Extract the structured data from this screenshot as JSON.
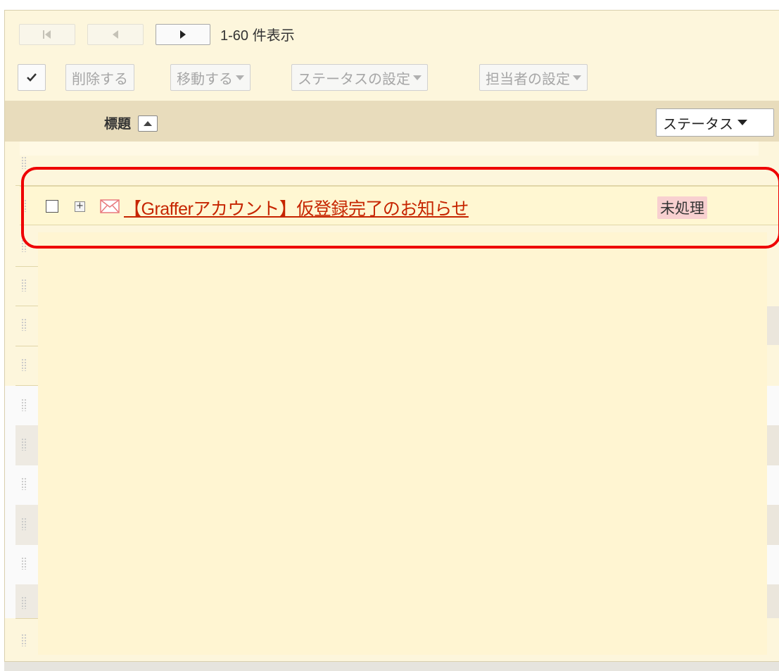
{
  "pager": {
    "first_label": "|◀",
    "prev_label": "◀",
    "next_label": "▶",
    "range_text": "1-60 件表示"
  },
  "toolbar": {
    "select_all_icon": "check-icon",
    "delete_label": "削除する",
    "move_label": "移動する",
    "status_setting_label": "ステータスの設定",
    "assignee_setting_label": "担当者の設定"
  },
  "list_header": {
    "title_label": "標題",
    "sort_icon": "sort-ascending-icon",
    "status_dropdown_label": "ステータス"
  },
  "messages": [
    {
      "subject": "【Grafferアカウント】仮登録完了のお知らせ",
      "status": "未処理",
      "icon": "envelope-icon"
    }
  ],
  "colors": {
    "panel_bg": "#fdf6dc",
    "header_bg": "#e8dcbc",
    "subject_link": "#c62500",
    "status_badge_bg": "#f8d0d0",
    "highlight_border": "#ee0000"
  }
}
